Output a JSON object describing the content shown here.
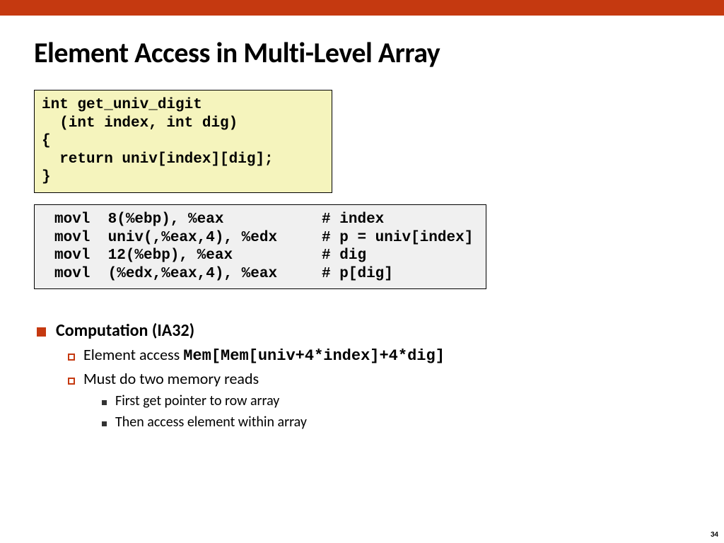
{
  "title": "Element Access in Multi-Level Array",
  "c_code": "int get_univ_digit\n  (int index, int dig)\n{\n  return univ[index][dig];\n}",
  "asm_code": "movl  8(%ebp), %eax           # index\nmovl  univ(,%eax,4), %edx     # p = univ[index]\nmovl  12(%ebp), %eax          # dig\nmovl  (%edx,%eax,4), %eax     # p[dig]",
  "bullets": {
    "l1": "Computation (IA32)",
    "l2a_prefix": "Element access ",
    "l2a_code": "Mem[Mem[univ+4*index]+4*dig]",
    "l2b": "Must do two memory reads",
    "l3a": "First get pointer to row array",
    "l3b": "Then access element within array"
  },
  "page_number": "34"
}
